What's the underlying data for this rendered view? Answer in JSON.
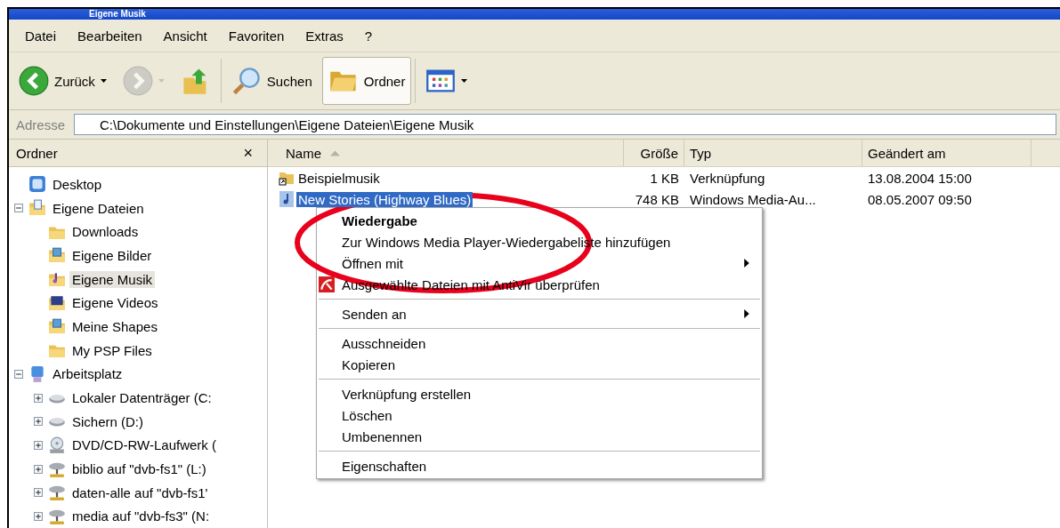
{
  "window": {
    "title": "Eigene Musik"
  },
  "menu_bar": [
    "Datei",
    "Bearbeiten",
    "Ansicht",
    "Favoriten",
    "Extras",
    "?"
  ],
  "toolbar": [
    {
      "kind": "back",
      "label": "Zurück",
      "dropdown": true,
      "disabled": false,
      "pressed": false
    },
    {
      "kind": "forward",
      "dropdown": true,
      "disabled": true,
      "pressed": false
    },
    {
      "kind": "up",
      "dropdown": false,
      "disabled": false,
      "pressed": false
    },
    {
      "kind": "search",
      "label": "Suchen",
      "dropdown": false,
      "disabled": false,
      "pressed": false
    },
    {
      "kind": "folders",
      "label": "Ordner",
      "dropdown": false,
      "disabled": false,
      "pressed": true
    },
    {
      "kind": "views",
      "dropdown": true,
      "disabled": false,
      "pressed": false
    }
  ],
  "address_bar": {
    "label": "Adresse",
    "value": "C:\\Dokumente und Einstellungen\\Eigene Dateien\\Eigene Musik"
  },
  "folder_pane": {
    "title": "Ordner",
    "close": "×",
    "tree": [
      {
        "label": "Desktop",
        "kind": "desktop",
        "selected": false,
        "children": [
          {
            "label": "Eigene Dateien",
            "kind": "documents",
            "expanded": true,
            "selected": false,
            "children": [
              {
                "label": "Downloads",
                "kind": "folder",
                "selected": false
              },
              {
                "label": "Eigene Bilder",
                "kind": "pictures",
                "selected": false
              },
              {
                "label": "Eigene Musik",
                "kind": "music",
                "selected": true
              },
              {
                "label": "Eigene Videos",
                "kind": "videos",
                "selected": false
              },
              {
                "label": "Meine Shapes",
                "kind": "pictures",
                "selected": false
              },
              {
                "label": "My PSP Files",
                "kind": "folder",
                "selected": false
              }
            ]
          },
          {
            "label": "Arbeitsplatz",
            "kind": "computer",
            "expanded": true,
            "selected": false,
            "children": [
              {
                "label": "Lokaler Datenträger (C:",
                "kind": "drive",
                "expanded": false,
                "selected": false
              },
              {
                "label": "Sichern (D:)",
                "kind": "drive",
                "expanded": false,
                "selected": false
              },
              {
                "label": "DVD/CD-RW-Laufwerk (",
                "kind": "cdrom",
                "expanded": false,
                "selected": false
              },
              {
                "label": "biblio auf \"dvb-fs1\" (L:)",
                "kind": "netdrive",
                "expanded": false,
                "selected": false
              },
              {
                "label": "daten-alle auf \"dvb-fs1'",
                "kind": "netdrive",
                "expanded": false,
                "selected": false
              },
              {
                "label": "media auf \"dvb-fs3\" (N:",
                "kind": "netdrive",
                "expanded": false,
                "selected": false
              }
            ]
          }
        ]
      }
    ]
  },
  "file_list": {
    "columns": [
      {
        "label": "Name",
        "sorted": true
      },
      {
        "label": "Größe",
        "sorted": false
      },
      {
        "label": "Typ",
        "sorted": false
      },
      {
        "label": "Geändert am",
        "sorted": false
      }
    ],
    "rows": [
      {
        "kind": "shortcut-folder",
        "name": "Beispielmusik",
        "size": "1 KB",
        "type": "Verknüpfung",
        "modified": "13.08.2004 15:00",
        "selected": false
      },
      {
        "kind": "audio",
        "name": "New Stories (Highway Blues)",
        "size": "748 KB",
        "type": "Windows Media-Au...",
        "modified": "08.05.2007 09:50",
        "selected": true
      }
    ]
  },
  "context_menu": {
    "groups": [
      [
        {
          "label": "Wiedergabe",
          "kind": "plain",
          "default": true,
          "submenu": false
        },
        {
          "label": "Zur Windows Media Player-Wiedergabeliste hinzufügen",
          "kind": "plain",
          "default": false,
          "submenu": false
        },
        {
          "label": "Öffnen mit",
          "kind": "plain",
          "default": false,
          "submenu": true
        },
        {
          "label": "Ausgewählte Dateien mit AntiVir überprüfen",
          "kind": "antivir",
          "default": false,
          "submenu": false
        }
      ],
      [
        {
          "label": "Senden an",
          "kind": "plain",
          "default": false,
          "submenu": true
        }
      ],
      [
        {
          "label": "Ausschneiden",
          "kind": "plain",
          "default": false,
          "submenu": false
        },
        {
          "label": "Kopieren",
          "kind": "plain",
          "default": false,
          "submenu": false
        }
      ],
      [
        {
          "label": "Verknüpfung erstellen",
          "kind": "plain",
          "default": false,
          "submenu": false
        },
        {
          "label": "Löschen",
          "kind": "plain",
          "default": false,
          "submenu": false
        },
        {
          "label": "Umbenennen",
          "kind": "plain",
          "default": false,
          "submenu": false
        }
      ],
      [
        {
          "label": "Eigenschaften",
          "kind": "plain",
          "default": false,
          "submenu": false
        }
      ]
    ]
  },
  "annotation": {
    "kind": "ellipse",
    "color": "#e8001c"
  }
}
